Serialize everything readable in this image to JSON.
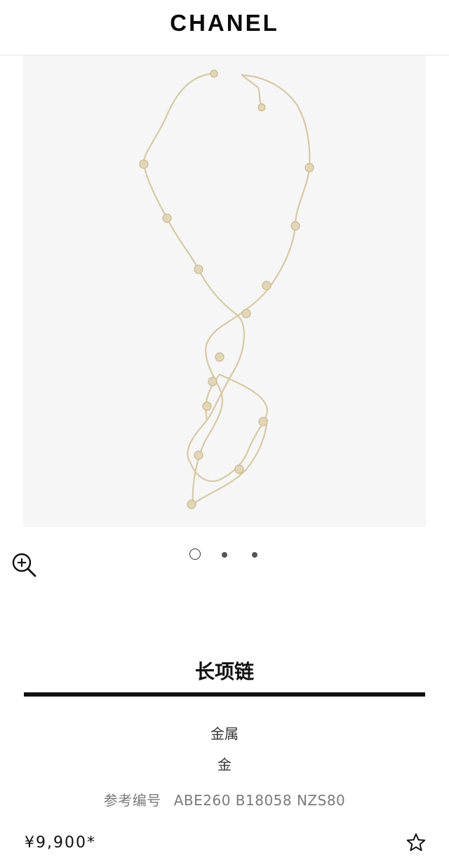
{
  "header": {
    "brand": "CHANEL"
  },
  "gallery": {
    "slides": 3,
    "active_slide": 1,
    "zoom_icon": "zoom-in-icon"
  },
  "product": {
    "name": "长项链",
    "material": "金属",
    "color": "金",
    "reference_label": "参考编号",
    "reference_code": "ABE260 B18058 NZS80",
    "price": "¥9,900*"
  },
  "actions": {
    "wishlist_icon": "star-outline-icon"
  },
  "colors": {
    "accent": "#111111",
    "photo_bg": "#f6f6f6",
    "chain_gold": "#d8c9a2"
  }
}
